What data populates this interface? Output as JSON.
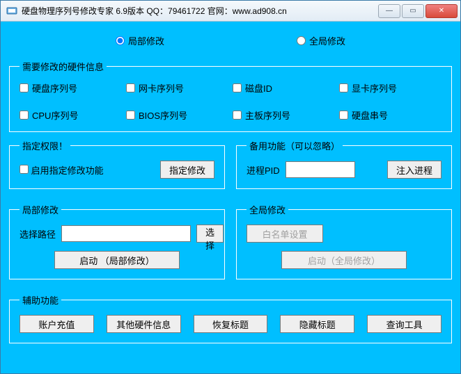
{
  "title": "硬盘物理序列号修改专家 6.9版本      QQ：79461722      官网：www.ad908.cn",
  "radios": {
    "local": "局部修改",
    "global": "全局修改",
    "selected": "local"
  },
  "hw": {
    "legend": "需要修改的硬件信息",
    "items": [
      "硬盘序列号",
      "网卡序列号",
      "磁盘ID",
      "显卡序列号",
      "CPU序列号",
      "BIOS序列号",
      "主板序列号",
      "硬盘串号"
    ]
  },
  "perm": {
    "legend": "指定权限！",
    "enable_label": "启用指定修改功能",
    "btn": "指定修改"
  },
  "backup": {
    "legend": "备用功能（可以忽略）",
    "pid_label": "进程PID",
    "pid_value": "",
    "btn": "注入进程"
  },
  "local_mod": {
    "legend": "局部修改",
    "path_label": "选择路径",
    "path_value": "",
    "choose_btn": "选择",
    "start_btn": "启动 （局部修改）"
  },
  "global_mod": {
    "legend": "全局修改",
    "whitelist_btn": "白名单设置",
    "start_btn": "启动（全局修改）"
  },
  "aux": {
    "legend": "辅助功能",
    "btns": [
      "账户充值",
      "其他硬件信息",
      "恢复标题",
      "隐藏标题",
      "查询工具"
    ]
  },
  "winbtns": {
    "min": "—",
    "max": "▭",
    "close": "✕"
  }
}
